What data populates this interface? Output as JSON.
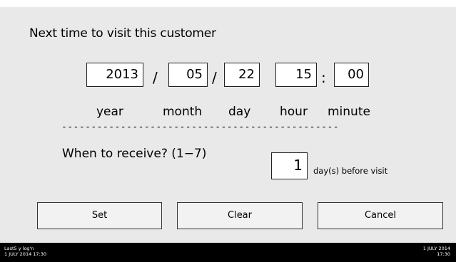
{
  "dialog": {
    "title": "Next time to visit this customer",
    "date_fields": [
      {
        "value": "2013",
        "unit": "year"
      },
      {
        "value": "05",
        "unit": "month"
      },
      {
        "value": "22",
        "unit": "day"
      },
      {
        "value": "15",
        "unit": "hour"
      },
      {
        "value": "00",
        "unit": "minute"
      }
    ],
    "date_separator": "/",
    "time_separator": ":",
    "divider": "-----------------------------------------------",
    "receive_label": "When to receive? (1−7)",
    "receive_days_value": "1",
    "receive_suffix": "day(s) before visit"
  },
  "buttons": {
    "set": "Set",
    "clear": "Clear",
    "cancel": "Cancel"
  },
  "status_bar": {
    "left_line1": "Last5 y log'n",
    "left_line2": "1 JULY 2014 17:30",
    "right_line1": "1 JULY 2014",
    "right_line2": "17:30"
  }
}
